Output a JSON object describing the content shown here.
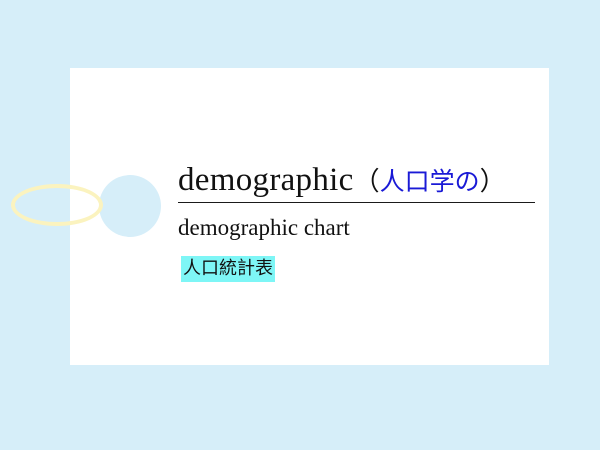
{
  "card": {
    "term": "demographic",
    "paren_open": "（",
    "meaning": "人口学の",
    "paren_close": "）",
    "phrase": "demographic chart",
    "phrase_translation": "人口統計表"
  },
  "colors": {
    "background": "#d6eef9",
    "card": "#ffffff",
    "meaning_text": "#1a1ad6",
    "highlight": "#7ef6f6",
    "ring": "#fbf3bf"
  }
}
